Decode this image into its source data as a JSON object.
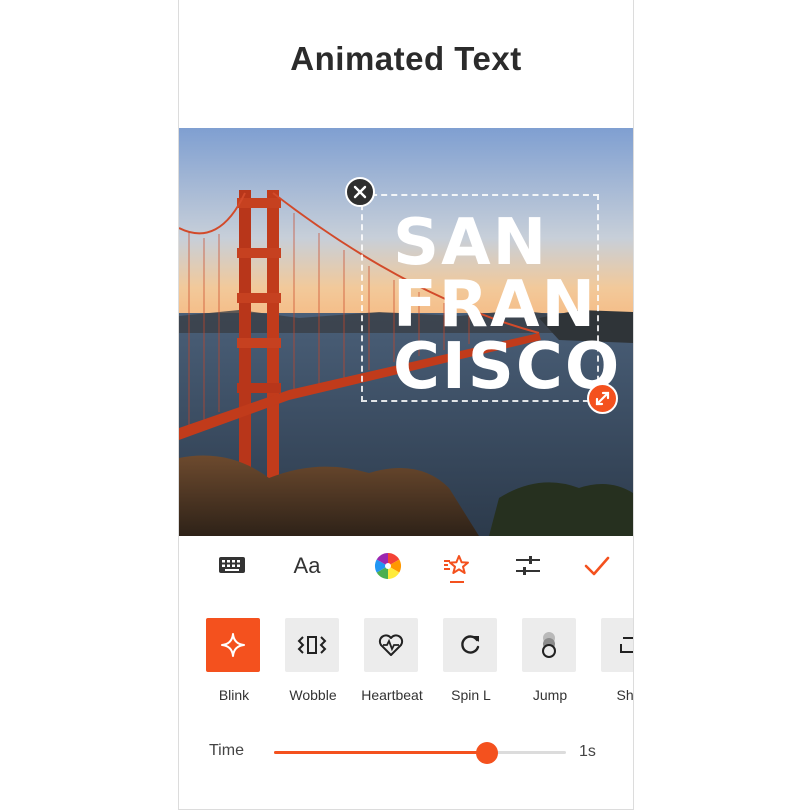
{
  "page": {
    "title": "Animated Text"
  },
  "canvas": {
    "overlay_lines": [
      "SAN",
      "FRAN",
      "CISCO"
    ],
    "close_icon": "close-icon",
    "resize_icon": "resize-diagonal-icon"
  },
  "toolbar": {
    "tools": [
      {
        "name": "keyboard",
        "icon": "keyboard-icon",
        "label": ""
      },
      {
        "name": "font",
        "icon": "font-icon",
        "label": "Aa"
      },
      {
        "name": "color",
        "icon": "color-wheel-icon",
        "label": ""
      },
      {
        "name": "animation",
        "icon": "animation-star-icon",
        "label": "",
        "active": true
      },
      {
        "name": "adjust",
        "icon": "sliders-icon",
        "label": ""
      },
      {
        "name": "confirm",
        "icon": "checkmark-icon",
        "label": ""
      }
    ]
  },
  "animations": [
    {
      "label": "Blink",
      "icon": "sparkle-icon",
      "selected": true
    },
    {
      "label": "Wobble",
      "icon": "wobble-icon",
      "selected": false
    },
    {
      "label": "Heartbeat",
      "icon": "heartbeat-icon",
      "selected": false
    },
    {
      "label": "Spin L",
      "icon": "rotate-left-icon",
      "selected": false
    },
    {
      "label": "Jump",
      "icon": "jump-icon",
      "selected": false
    },
    {
      "label": "Sha",
      "icon": "shake-icon",
      "selected": false
    }
  ],
  "time": {
    "label": "Time",
    "value": "1s",
    "level": 0.73
  },
  "colors": {
    "accent": "#f4511e",
    "text": "#2b2b2b",
    "tile": "#ececec"
  }
}
